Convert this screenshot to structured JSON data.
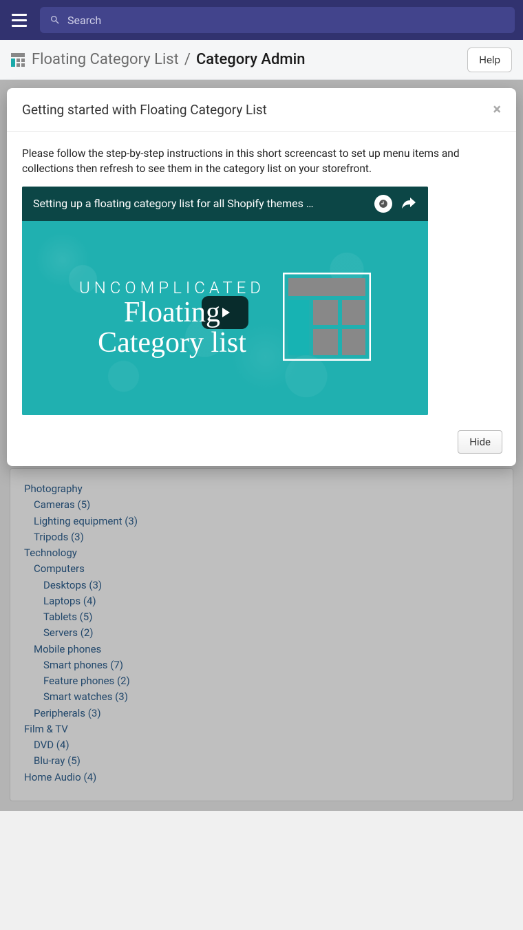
{
  "search": {
    "placeholder": "Search"
  },
  "breadcrumb": {
    "app": "Floating Category List",
    "sep": "/",
    "current": "Category Admin"
  },
  "help_label": "Help",
  "modal": {
    "title": "Getting started with Floating Category List",
    "instructions": "Please follow the step-by-step instructions in this short screencast to set up menu items and collections then refresh to see them in the category list on your storefront.",
    "video_title": "Setting up a floating category list for all Shopify themes …",
    "thumb_line1": "UNCOMPLICATED",
    "thumb_line2": "Floating",
    "thumb_line3": "Category list",
    "hide_label": "Hide"
  },
  "tree": [
    {
      "label": "Photography",
      "level": 1,
      "children": [
        {
          "label": "Cameras (5)",
          "level": 2
        },
        {
          "label": "Lighting equipment (3)",
          "level": 2
        },
        {
          "label": "Tripods (3)",
          "level": 2
        }
      ]
    },
    {
      "label": "Technology",
      "level": 1,
      "children": [
        {
          "label": "Computers",
          "level": 2,
          "children": [
            {
              "label": "Desktops (3)",
              "level": 3
            },
            {
              "label": "Laptops (4)",
              "level": 3
            },
            {
              "label": "Tablets (5)",
              "level": 3
            },
            {
              "label": "Servers (2)",
              "level": 3
            }
          ]
        },
        {
          "label": "Mobile phones",
          "level": 2,
          "children": [
            {
              "label": "Smart phones (7)",
              "level": 3
            },
            {
              "label": "Feature phones (2)",
              "level": 3
            },
            {
              "label": "Smart watches (3)",
              "level": 3
            }
          ]
        },
        {
          "label": "Peripherals (3)",
          "level": 2
        }
      ]
    },
    {
      "label": "Film & TV",
      "level": 1,
      "children": [
        {
          "label": "DVD (4)",
          "level": 2
        },
        {
          "label": "Blu-ray (5)",
          "level": 2
        }
      ]
    },
    {
      "label": "Home Audio (4)",
      "level": 1
    }
  ]
}
